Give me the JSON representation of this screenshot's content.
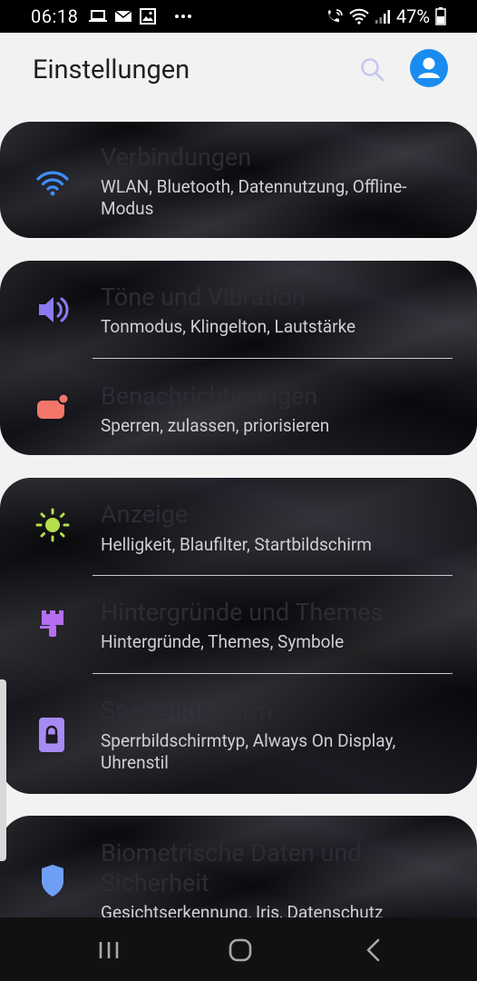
{
  "status_bar": {
    "time": "06:18",
    "battery_percent": "47%",
    "icons": [
      "laptop-icon",
      "mail-icon",
      "gallery-icon",
      "more-icon",
      "wifi-calling-icon",
      "wifi-icon",
      "signal-icon",
      "battery-icon"
    ]
  },
  "header": {
    "title": "Einstellungen"
  },
  "cards": [
    {
      "items": [
        {
          "title": "Verbindungen",
          "subtitle": "WLAN, Bluetooth, Datennutzung, Offline-Modus",
          "icon": "wifi-icon",
          "color": "#3d8ff5"
        }
      ]
    },
    {
      "items": [
        {
          "title": "Töne und Vibration",
          "subtitle": "Tonmodus, Klingelton, Lautstärke",
          "icon": "volume-icon",
          "color": "#8a7af2"
        },
        {
          "title": "Benachrichtigungen",
          "subtitle": "Sperren, zulassen, priorisieren",
          "icon": "notification-icon",
          "color": "#f2756a"
        }
      ]
    },
    {
      "items": [
        {
          "title": "Anzeige",
          "subtitle": "Helligkeit, Blaufilter, Startbildschirm",
          "icon": "brightness-icon",
          "color": "#b5e04a"
        },
        {
          "title": "Hintergründe und Themes",
          "subtitle": "Hintergründe, Themes, Symbole",
          "icon": "paintbrush-icon",
          "color": "#b46ef0"
        },
        {
          "title": "Sperrbildschirm",
          "subtitle": "Sperrbildschirmtyp, Always On Display, Uhrenstil",
          "icon": "lock-icon",
          "color": "#a88af4"
        }
      ]
    },
    {
      "items": [
        {
          "title": "Biometrische Daten und Sicherheit",
          "subtitle": "Gesichtserkennung, Iris, Datenschutz",
          "icon": "shield-icon",
          "color": "#6f9ff5"
        }
      ]
    }
  ]
}
